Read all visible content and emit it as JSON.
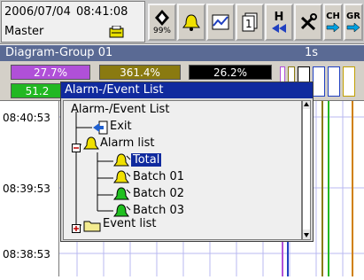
{
  "status": {
    "date": "2006/07/04",
    "time": "08:41:08",
    "user": "Master"
  },
  "toolbar": {
    "zoom_label": "99%",
    "buttons": [
      {
        "name": "navigation-button",
        "icon": "diamond-arrows-icon"
      },
      {
        "name": "alarm-button",
        "icon": "alarm-bell-icon"
      },
      {
        "name": "diagram-button",
        "icon": "diagram-icon"
      },
      {
        "name": "pages-button",
        "icon": "pages-icon"
      },
      {
        "name": "history-button",
        "icon": "history-icon"
      },
      {
        "name": "tools-button",
        "icon": "tools-icon"
      },
      {
        "name": "channel-button",
        "icon": "channel-icon"
      },
      {
        "name": "group-button",
        "icon": "group-icon"
      }
    ],
    "history_label": "H",
    "channel_label": "CH",
    "group_label": "GR"
  },
  "diagram": {
    "title": "Diagram-Group 01",
    "interval": "1s"
  },
  "values": {
    "v1": "27.7%",
    "v2": "361.4%",
    "v3": "26.2%",
    "v4": "51.2"
  },
  "time_labels": [
    "08:40:53",
    "08:39:53",
    "08:38:53"
  ],
  "popup": {
    "title": "Alarm-/Event List",
    "root": "Alarm-/Event List",
    "items": {
      "exit": "Exit",
      "alarm_list": "Alarm list",
      "total": "Total",
      "batch01": "Batch 01",
      "batch02": "Batch 02",
      "batch03": "Batch 03",
      "event_list": "Event list"
    }
  },
  "colors": {
    "title_bar": "#102a9e",
    "header": "#5a6a94",
    "purple": "#b050d8",
    "olive": "#8a7a10",
    "green": "#22b822",
    "black": "#000000"
  }
}
